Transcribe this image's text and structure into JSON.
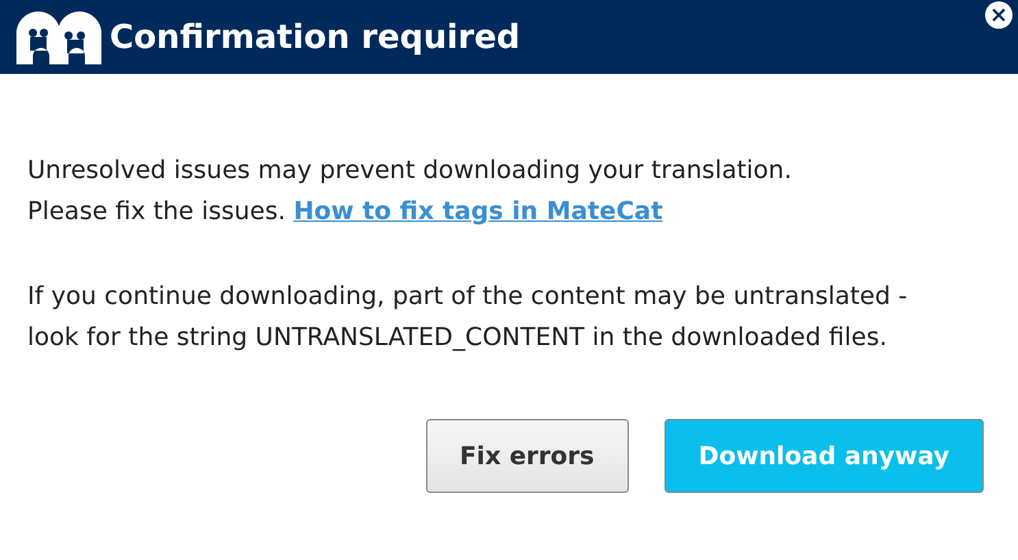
{
  "dialog": {
    "title": "Confirmation required",
    "close_label": "×"
  },
  "message": {
    "line_1": "Unresolved issues may prevent downloading your translation.",
    "line_2": "Please fix the issues.",
    "link": "How to fix tags in MateCat",
    "paragraph_2": "If you continue downloading, part of the content may be untranslated - look for the string UNTRANSLATED_CONTENT in the downloaded files."
  },
  "buttons": [
    {
      "label": "Fix errors",
      "kind": "secondary"
    },
    {
      "label": "Download anyway",
      "kind": "primary"
    }
  ]
}
